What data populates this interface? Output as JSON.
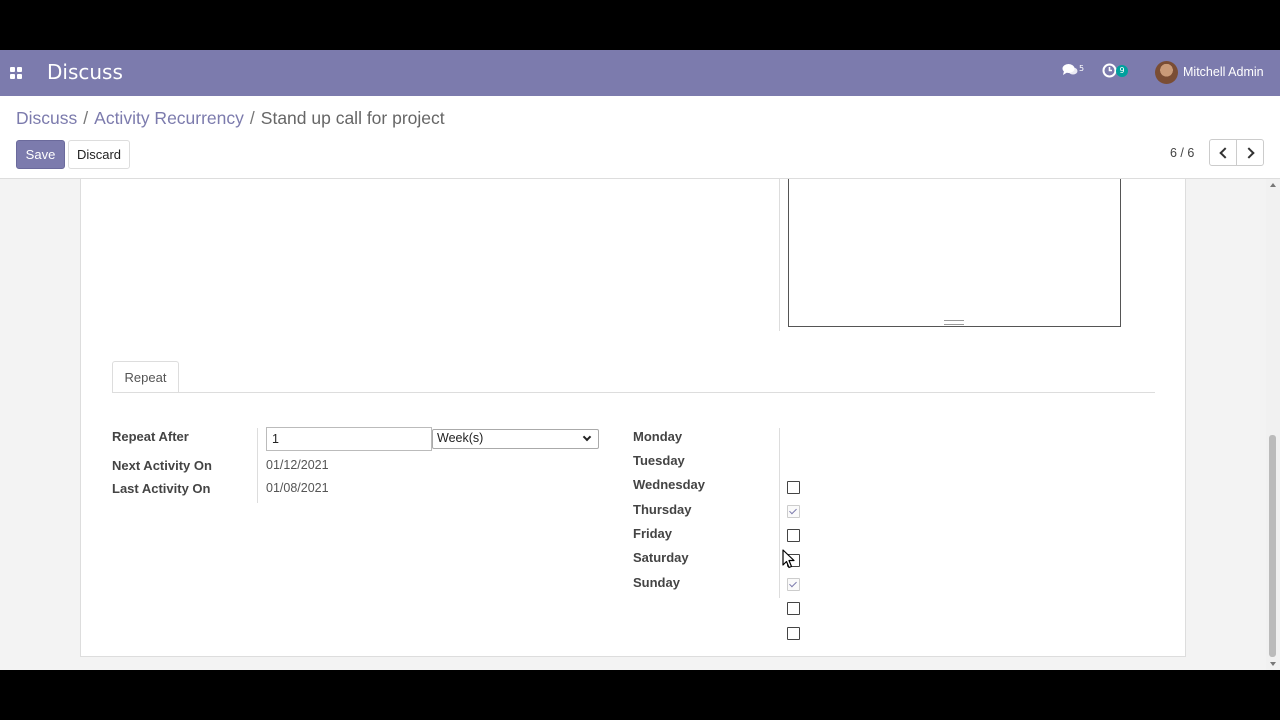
{
  "navbar": {
    "app_title": "Discuss",
    "chat_badge": "5",
    "activity_badge": "9",
    "user_name": "Mitchell Admin",
    "color": "#7c7bad"
  },
  "breadcrumb": {
    "items": [
      "Discuss",
      "Activity Recurrency",
      "Stand up call for project"
    ],
    "separator": "/"
  },
  "toolbar": {
    "save_label": "Save",
    "discard_label": "Discard",
    "pager_value": "6 / 6"
  },
  "tabs": [
    {
      "label": "Repeat",
      "active": true
    }
  ],
  "repeat": {
    "repeat_after_label": "Repeat After",
    "repeat_after_value": "1",
    "repeat_unit": "Week(s)",
    "next_activity_label": "Next Activity On",
    "next_activity_value": "01/12/2021",
    "last_activity_label": "Last Activity On",
    "last_activity_value": "01/08/2021"
  },
  "weekdays": [
    {
      "label": "Monday",
      "checked": false
    },
    {
      "label": "Tuesday",
      "checked": true
    },
    {
      "label": "Wednesday",
      "checked": false
    },
    {
      "label": "Thursday",
      "checked": false
    },
    {
      "label": "Friday",
      "checked": true
    },
    {
      "label": "Saturday",
      "checked": false
    },
    {
      "label": "Sunday",
      "checked": false
    }
  ]
}
